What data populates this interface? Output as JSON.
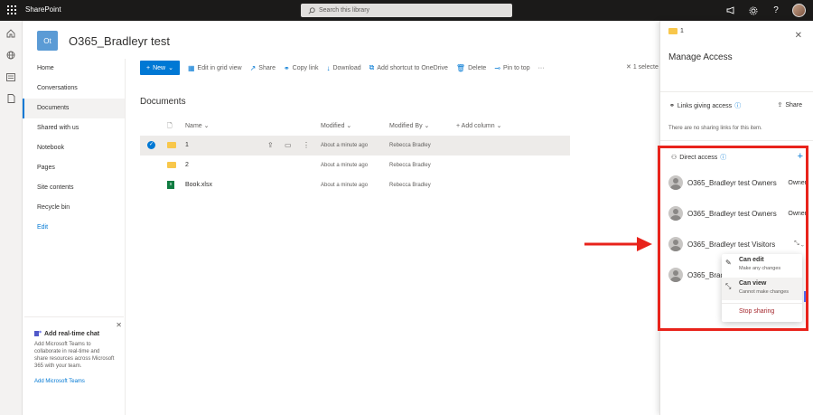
{
  "topbar": {
    "brand": "SharePoint",
    "search_placeholder": "Search this library"
  },
  "site": {
    "initials": "Ot",
    "title": "O365_Bradleyr test"
  },
  "nav": [
    "Home",
    "Conversations",
    "Documents",
    "Shared with us",
    "Notebook",
    "Pages",
    "Site contents",
    "Recycle bin",
    "Edit"
  ],
  "chat": {
    "title": "Add real-time chat",
    "description": "Add Microsoft Teams to collaborate in real-time and share resources across Microsoft 365 with your team.",
    "link": "Add Microsoft Teams"
  },
  "commands": {
    "new": "New",
    "grid": "Edit in grid view",
    "share": "Share",
    "copy": "Copy link",
    "download": "Download",
    "shortcut": "Add shortcut to OneDrive",
    "delete": "Delete",
    "pin": "Pin to top",
    "more": "···",
    "selected": "1 selecte"
  },
  "library": {
    "title": "Documents",
    "columns": {
      "name": "Name",
      "modified": "Modified",
      "modified_by": "Modified By",
      "add": "Add column"
    },
    "rows": [
      {
        "name": "1",
        "modified": "About a minute ago",
        "by": "Rebecca Bradley"
      },
      {
        "name": "2",
        "modified": "About a minute ago",
        "by": "Rebecca Bradley"
      },
      {
        "name": "Book.xlsx",
        "modified": "About a minute ago",
        "by": "Rebecca Bradley"
      }
    ]
  },
  "panel": {
    "crumb": "1",
    "title": "Manage Access",
    "links_header": "Links giving access",
    "share": "Share",
    "no_links": "There are no sharing links for this item.",
    "direct_header": "Direct access",
    "people": [
      {
        "name": "O365_Bradleyr test Owners",
        "role": "Owner"
      },
      {
        "name": "O365_Bradleyr test Owners",
        "role": "Owner"
      },
      {
        "name": "O365_Bradleyr test Visitors",
        "role": ""
      },
      {
        "name": "O365_Bradl",
        "role": ""
      }
    ],
    "dropdown": {
      "edit_title": "Can edit",
      "edit_sub": "Make any changes",
      "view_title": "Can view",
      "view_sub": "Cannot make changes",
      "stop": "Stop sharing"
    }
  },
  "colors": {
    "accent": "#0078d4",
    "highlight_box": "#e8231b",
    "topbar": "#1b1a19"
  }
}
